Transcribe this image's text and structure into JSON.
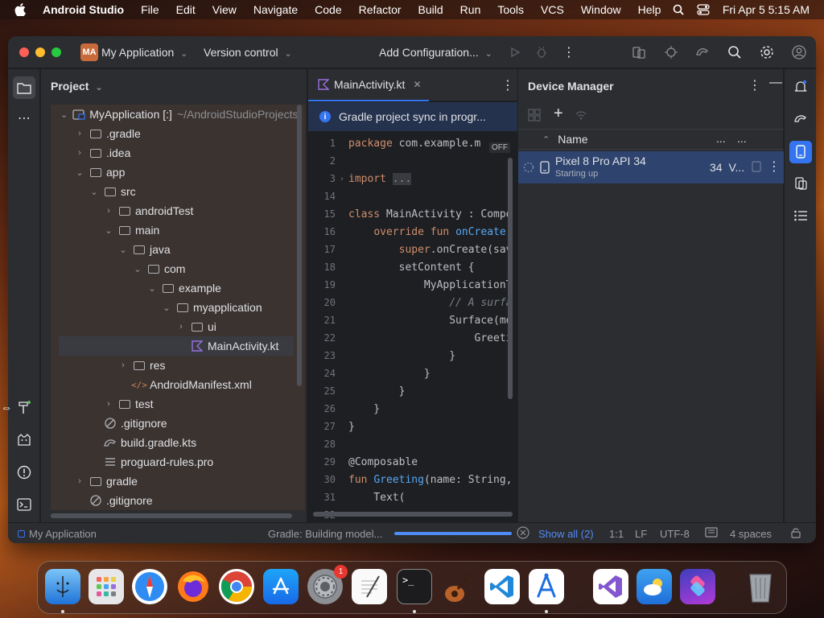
{
  "menubar": {
    "apple": "",
    "items": [
      "Android Studio",
      "File",
      "Edit",
      "View",
      "Navigate",
      "Code",
      "Refactor",
      "Build",
      "Run",
      "Tools",
      "VCS",
      "Window",
      "Help"
    ],
    "datetime": "Fri Apr 5  5:15 AM"
  },
  "titlebar": {
    "project_badge": "MA",
    "project_name": "My Application",
    "vcs": "Version control",
    "config": "Add Configuration..."
  },
  "project_panel": {
    "title": "Project",
    "tree": [
      {
        "label": "MyApplication [:]",
        "hint": "~/AndroidStudioProjects",
        "depth": 0,
        "chev": "⌄",
        "icon": "module"
      },
      {
        "label": ".gradle",
        "depth": 1,
        "chev": "›",
        "icon": "folder"
      },
      {
        "label": ".idea",
        "depth": 1,
        "chev": "›",
        "icon": "folder"
      },
      {
        "label": "app",
        "depth": 1,
        "chev": "⌄",
        "icon": "folder"
      },
      {
        "label": "src",
        "depth": 2,
        "chev": "⌄",
        "icon": "folder"
      },
      {
        "label": "androidTest",
        "depth": 3,
        "chev": "›",
        "icon": "folder"
      },
      {
        "label": "main",
        "depth": 3,
        "chev": "⌄",
        "icon": "folder"
      },
      {
        "label": "java",
        "depth": 4,
        "chev": "⌄",
        "icon": "folder"
      },
      {
        "label": "com",
        "depth": 5,
        "chev": "⌄",
        "icon": "folder"
      },
      {
        "label": "example",
        "depth": 6,
        "chev": "⌄",
        "icon": "folder"
      },
      {
        "label": "myapplication",
        "depth": 7,
        "chev": "⌄",
        "icon": "folder"
      },
      {
        "label": "ui",
        "depth": 8,
        "chev": "›",
        "icon": "folder"
      },
      {
        "label": "MainActivity.kt",
        "depth": 8,
        "chev": "",
        "icon": "kotlin",
        "selected": true
      },
      {
        "label": "res",
        "depth": 4,
        "chev": "›",
        "icon": "folder"
      },
      {
        "label": "AndroidManifest.xml",
        "depth": 4,
        "chev": "",
        "icon": "xml"
      },
      {
        "label": "test",
        "depth": 3,
        "chev": "›",
        "icon": "folder"
      },
      {
        "label": ".gitignore",
        "depth": 2,
        "chev": "",
        "icon": "ignore"
      },
      {
        "label": "build.gradle.kts",
        "depth": 2,
        "chev": "",
        "icon": "gradle"
      },
      {
        "label": "proguard-rules.pro",
        "depth": 2,
        "chev": "",
        "icon": "text"
      },
      {
        "label": "gradle",
        "depth": 1,
        "chev": "›",
        "icon": "folder"
      },
      {
        "label": ".gitignore",
        "depth": 1,
        "chev": "",
        "icon": "ignore"
      }
    ]
  },
  "editor": {
    "tab": "MainActivity.kt",
    "banner": "Gradle project sync in progr...",
    "off_badge": "OFF",
    "lines": [
      {
        "n": "1",
        "fold": "",
        "html": "<span class='kw'>package</span> com.example.m"
      },
      {
        "n": "2",
        "fold": "",
        "html": ""
      },
      {
        "n": "3",
        "fold": "›",
        "html": "<span class='kw'>import</span> <span style='background:#393b40;color:#8c8f94'>...</span>"
      },
      {
        "n": "14",
        "fold": "",
        "html": ""
      },
      {
        "n": "15",
        "fold": "",
        "html": "<span class='kw'>class</span> MainActivity : Compo"
      },
      {
        "n": "16",
        "fold": "",
        "html": "    <span class='kw'>override fun</span> <span class='fn'>onCreate</span>("
      },
      {
        "n": "17",
        "fold": "",
        "html": "        <span class='kw'>super</span>.onCreate(sav"
      },
      {
        "n": "18",
        "fold": "",
        "html": "        setContent {"
      },
      {
        "n": "19",
        "fold": "",
        "html": "            MyApplicationT"
      },
      {
        "n": "20",
        "fold": "",
        "html": "                <span class='cm'>// A surfa</span>"
      },
      {
        "n": "21",
        "fold": "",
        "html": "                Surface(mo"
      },
      {
        "n": "22",
        "fold": "",
        "html": "                    Greeti"
      },
      {
        "n": "23",
        "fold": "",
        "html": "                }"
      },
      {
        "n": "24",
        "fold": "",
        "html": "            }"
      },
      {
        "n": "25",
        "fold": "",
        "html": "        }"
      },
      {
        "n": "26",
        "fold": "",
        "html": "    }"
      },
      {
        "n": "27",
        "fold": "",
        "html": "}"
      },
      {
        "n": "28",
        "fold": "",
        "html": ""
      },
      {
        "n": "29",
        "fold": "",
        "html": "@Composable"
      },
      {
        "n": "30",
        "fold": "",
        "html": "<span class='kw'>fun</span> <span class='fn'>Greeting</span>(name: String,"
      },
      {
        "n": "31",
        "fold": "",
        "html": "    Text("
      },
      {
        "n": "32",
        "fold": "",
        "html": ""
      }
    ]
  },
  "device_manager": {
    "title": "Device Manager",
    "col_name": "Name",
    "col_more": "...",
    "device": {
      "name": "Pixel 8 Pro API 34",
      "status": "Starting up",
      "api": "34",
      "api_more": "V..."
    }
  },
  "statusbar": {
    "project": "My Application",
    "task": "Gradle: Building model...",
    "progress": 1.0,
    "show_all": "Show all (2)",
    "position": "1:1",
    "line_sep": "LF",
    "encoding": "UTF-8",
    "indent": "4 spaces"
  },
  "dock": {
    "badge": "1",
    "apps": [
      "finder",
      "launchpad",
      "safari",
      "firefox",
      "chrome",
      "app-store",
      "system-settings",
      "textedit",
      "terminal",
      "garageband",
      "vscode",
      "xcode-instruments",
      "visual-studio",
      "weather",
      "shortcuts",
      "trash"
    ]
  },
  "colors": {
    "accent": "#3574f0",
    "selection": "#2e436e",
    "panel": "#2b2d30",
    "editor_bg": "#1e1f22"
  }
}
